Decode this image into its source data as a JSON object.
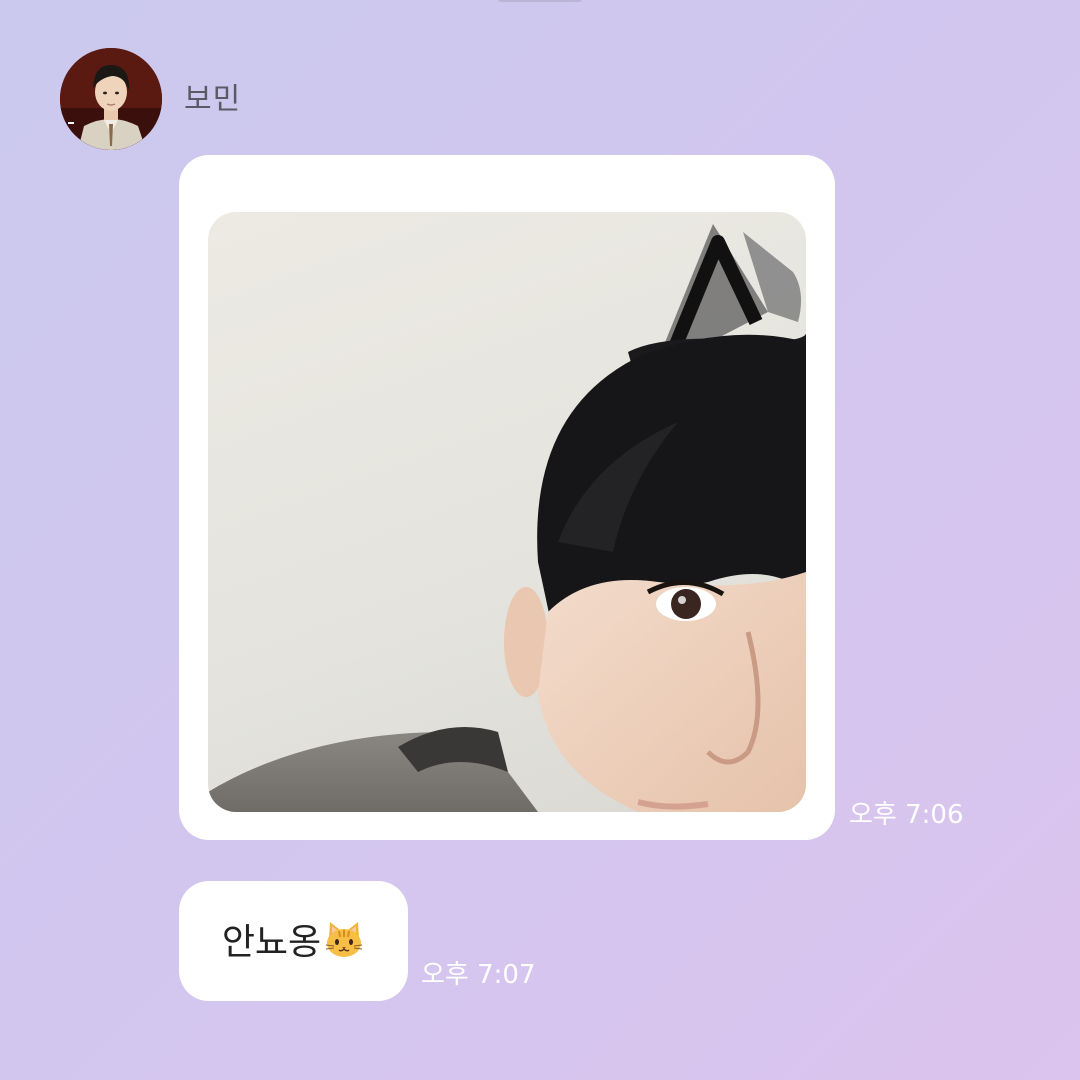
{
  "chat": {
    "sender": {
      "name": "보민"
    },
    "messages": [
      {
        "type": "photo",
        "time": "오후 7:06"
      },
      {
        "type": "text",
        "text": "안뇨옹",
        "emoji": "cat-face",
        "time": "오후 7:07"
      }
    ]
  },
  "colors": {
    "background_start": "#cbc9ee",
    "background_end": "#dbc4ee",
    "bubble": "#ffffff",
    "timestamp": "#ffffff",
    "sender_name": "#5a5a66"
  }
}
